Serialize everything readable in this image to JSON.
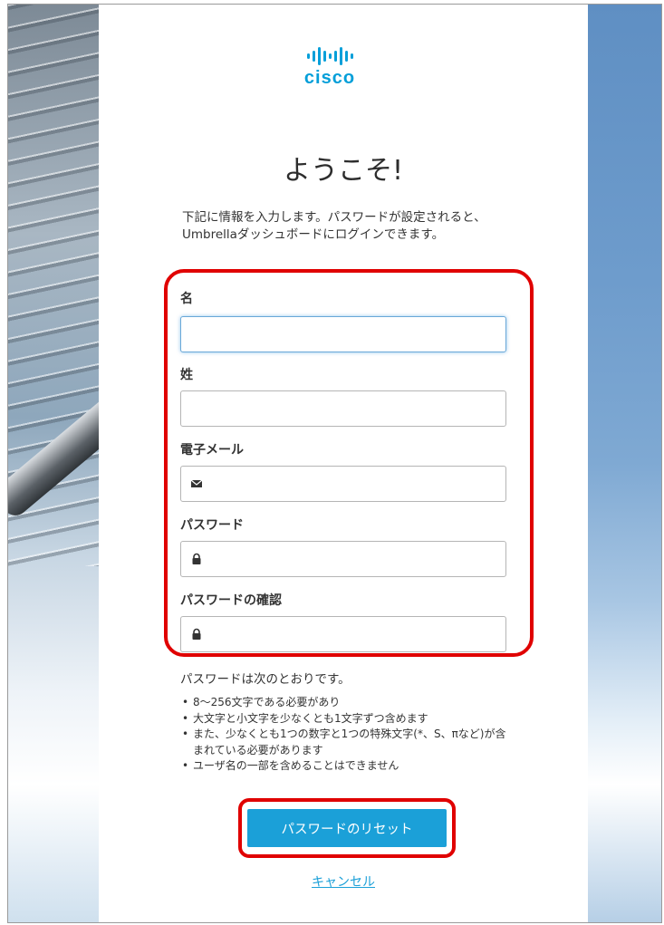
{
  "brand": {
    "logo_text": "cisco",
    "accent_color": "#049fd9"
  },
  "page": {
    "title": "ようこそ!",
    "intro": "下記に情報を入力します。パスワードが設定されると、Umbrellaダッシュボードにログインできます。"
  },
  "form": {
    "first_name": {
      "label": "名",
      "value": ""
    },
    "last_name": {
      "label": "姓",
      "value": ""
    },
    "email": {
      "label": "電子メール",
      "value": "",
      "icon": "envelope-icon"
    },
    "password": {
      "label": "パスワード",
      "value": "",
      "icon": "lock-icon"
    },
    "confirm_password": {
      "label": "パスワードの確認",
      "value": "",
      "icon": "lock-icon"
    }
  },
  "requirements": {
    "title": "パスワードは次のとおりです。",
    "items": [
      "8～256文字である必要があり",
      "大文字と小文字を少なくとも1文字ずつ含めます",
      "また、少なくとも1つの数字と1つの特殊文字(*、S、πなど)が含まれている必要があります",
      "ユーザ名の一部を含めることはできません"
    ]
  },
  "actions": {
    "reset_label": "パスワードのリセット",
    "cancel_label": "キャンセル"
  },
  "colors": {
    "highlight": "#e00000",
    "button": "#1ba0d8"
  }
}
